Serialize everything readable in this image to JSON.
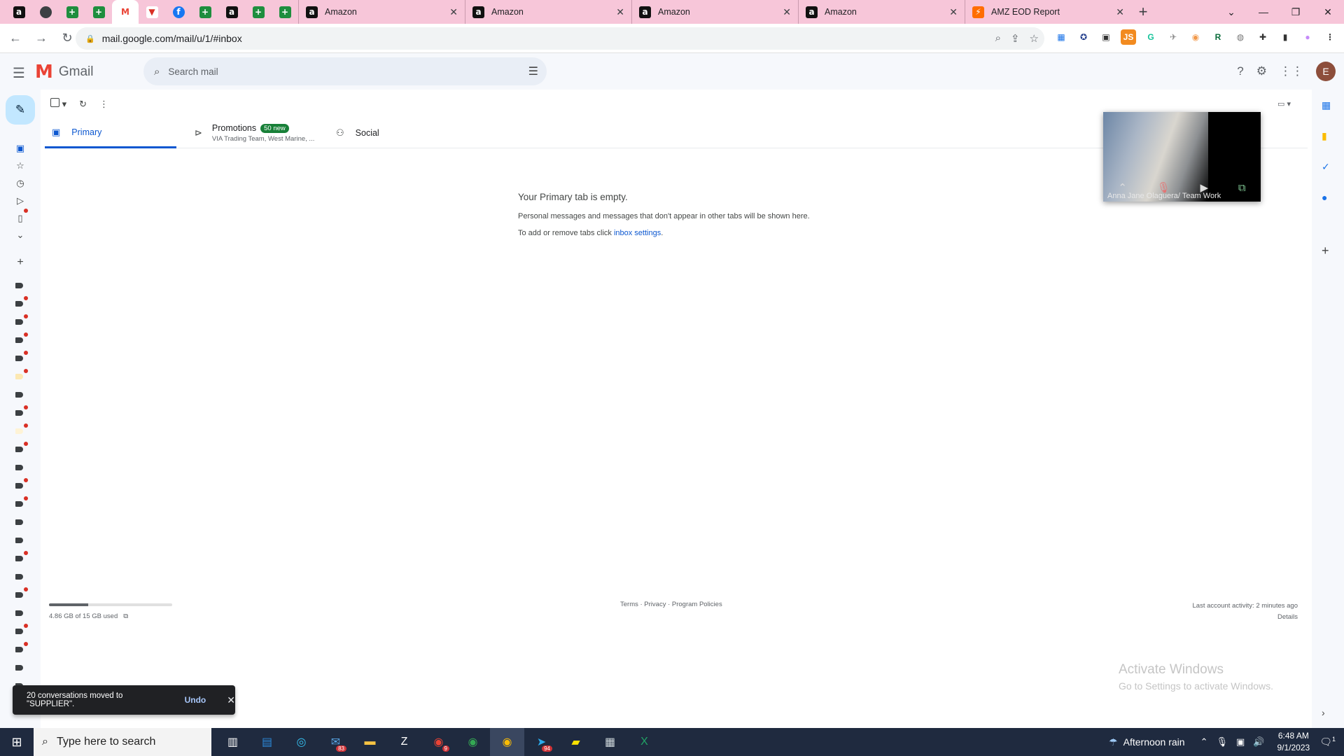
{
  "browser": {
    "pinned_tabs": [
      {
        "icon": "amazon-icon",
        "glyph": "a",
        "kind": "amz"
      },
      {
        "icon": "circle-icon",
        "glyph": "",
        "kind": "circle"
      },
      {
        "icon": "sheets-icon",
        "glyph": "+",
        "kind": "sheet"
      },
      {
        "icon": "sheets-icon",
        "glyph": "+",
        "kind": "sheet"
      },
      {
        "icon": "gmail-icon",
        "glyph": "M",
        "kind": "gmail"
      },
      {
        "icon": "retailer-icon",
        "glyph": "▼",
        "kind": "ret"
      },
      {
        "icon": "facebook-icon",
        "glyph": "f",
        "kind": "fb"
      },
      {
        "icon": "sheets-icon",
        "glyph": "+",
        "kind": "sheet"
      },
      {
        "icon": "amazon-icon",
        "glyph": "a",
        "kind": "amz"
      },
      {
        "icon": "sheets-icon",
        "glyph": "+",
        "kind": "sheet"
      },
      {
        "icon": "sheets-icon",
        "glyph": "+",
        "kind": "sheet"
      }
    ],
    "tabs": [
      {
        "title": "Amazon"
      },
      {
        "title": "Amazon"
      },
      {
        "title": "Amazon"
      },
      {
        "title": "Amazon"
      },
      {
        "title": "AMZ EOD Report"
      }
    ],
    "url": "mail.google.com/mail/u/1/#inbox"
  },
  "gmail": {
    "app_name": "Gmail",
    "search_placeholder": "Search mail",
    "avatar_letter": "E",
    "tabs": {
      "primary": "Primary",
      "promotions": "Promotions",
      "promotions_badge": "50 new",
      "promotions_sub": "VIA Trading Team, West Marine, ...",
      "social": "Social"
    },
    "empty": {
      "heading": "Your Primary tab is empty.",
      "line1": "Personal messages and messages that don't appear in other tabs will be shown here.",
      "line2_prefix": "To add or remove tabs click ",
      "line2_link": "inbox settings",
      "line2_suffix": "."
    },
    "storage": {
      "text": "4.86 GB of 15 GB used",
      "used_fraction": 0.32
    },
    "footer": {
      "links": "Terms · Privacy · Program Policies",
      "activity": "Last account activity: 2 minutes ago",
      "details": "Details"
    },
    "snackbar": {
      "message": "20 conversations moved to \"SUPPLIER\".",
      "action": "Undo"
    }
  },
  "video": {
    "caption": "Anna Jane Olaguera/ Team Work"
  },
  "watermark": {
    "title": "Activate Windows",
    "subtitle": "Go to Settings to activate Windows."
  },
  "taskbar": {
    "search_placeholder": "Type here to search",
    "weather": "Afternoon rain",
    "time": "6:48 AM",
    "date": "9/1/2023",
    "notification_count": "1",
    "mail_badge": "83",
    "chrome_badge": "9",
    "telegram_badge": "94"
  }
}
